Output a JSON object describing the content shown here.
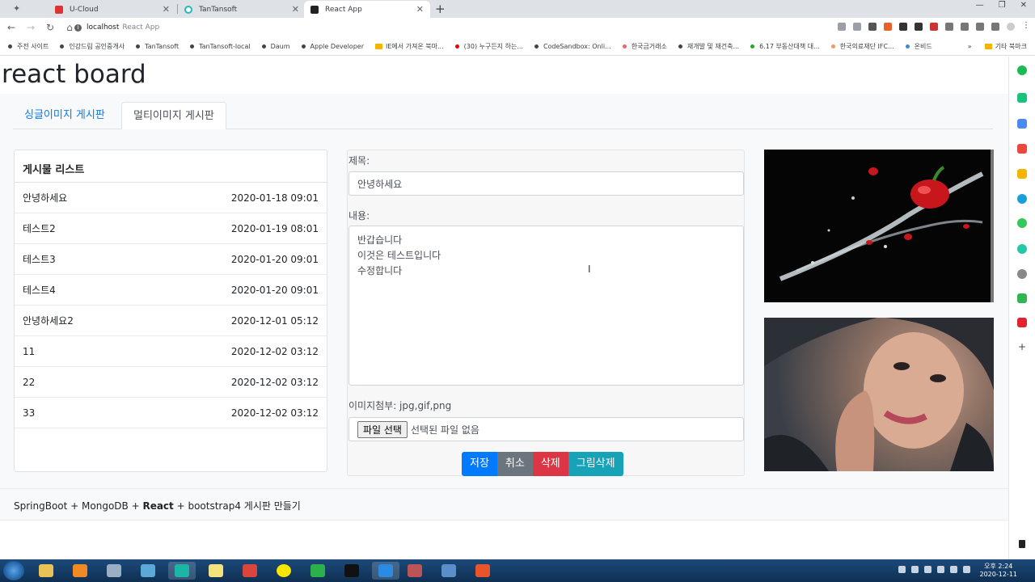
{
  "browser": {
    "tabs": [
      {
        "title": "U-Cloud",
        "active": false
      },
      {
        "title": "TanTansoft",
        "active": false
      },
      {
        "title": "React App",
        "active": true
      }
    ],
    "url_host": "localhost",
    "url_title": "React App",
    "bookmarks": [
      "주전 사이트",
      "인강드림 공인중개사",
      "TanTansoft",
      "TanTansoft-local",
      "Daum",
      "Apple Developer",
      "IE에서 가져온 북마...",
      "(30) 누구든지 하는...",
      "CodeSandbox: Onli...",
      "한국금거래소",
      "재개발 및 재건축...",
      "6.17 부동산대책 대...",
      "한국의료재단 IFC...",
      "온비드"
    ],
    "bookmarks_more": "»",
    "other_bookmarks": "기타 북마크"
  },
  "app": {
    "heading": "react board",
    "tabs": [
      "싱글이미지 게시판",
      "멀티이미지 게시판"
    ],
    "list": {
      "header": "게시물 리스트",
      "rows": [
        {
          "title": "안녕하세요",
          "date": "2020-01-18 09:01"
        },
        {
          "title": "테스트2",
          "date": "2020-01-19 08:01"
        },
        {
          "title": "테스트3",
          "date": "2020-01-20 09:01"
        },
        {
          "title": "테스트4",
          "date": "2020-01-20 09:01"
        },
        {
          "title": "안녕하세요2",
          "date": "2020-12-01 05:12"
        },
        {
          "title": "11",
          "date": "2020-12-02 03:12"
        },
        {
          "title": "22",
          "date": "2020-12-02 03:12"
        },
        {
          "title": "33",
          "date": "2020-12-02 03:12"
        }
      ]
    },
    "form": {
      "title_label": "제목:",
      "title_value": "안녕하세요",
      "content_label": "내용:",
      "content_value": "반갑습니다\n이것은 테스트입니다\n수정합니다",
      "attach_label": "이미지첨부: jpg,gif,png",
      "file_button": "파일 선택",
      "file_status": "선택된 파일 없음",
      "buttons": {
        "save": "저장",
        "cancel": "취소",
        "delete": "삭제",
        "image_delete": "그림삭제"
      }
    },
    "footer_prefix": "SpringBoot + MongoDB + ",
    "footer_bold": "React",
    "footer_suffix": " + bootstrap4 게시판 만들기"
  },
  "taskbar": {
    "time": "오후 2:24",
    "date": "2020-12-11"
  },
  "colors": {
    "primary": "#007bff",
    "secondary": "#6c757d",
    "danger": "#dc3545",
    "info": "#17a2b8"
  }
}
